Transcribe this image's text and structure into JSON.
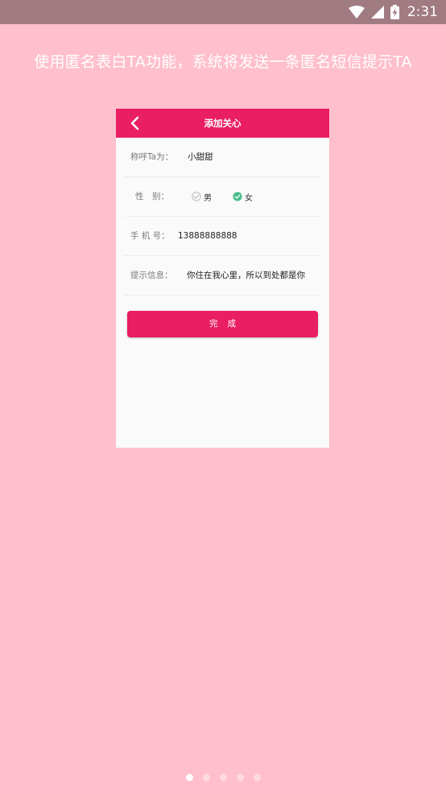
{
  "status_bar": {
    "time": "2:31",
    "icons": [
      "wifi-icon",
      "signal-icon",
      "battery-charging-icon"
    ]
  },
  "banner": {
    "text": "使用匿名表白TA功能，系统将发送一条匿名短信提示TA"
  },
  "card": {
    "title": "添加关心",
    "fields": {
      "nickname": {
        "label": "称呼Ta为：",
        "value": "小甜甜"
      },
      "gender": {
        "label": "性　别：",
        "options": [
          {
            "label": "男",
            "selected": false
          },
          {
            "label": "女",
            "selected": true
          }
        ]
      },
      "phone": {
        "label": "手 机 号：",
        "value": "13888888888"
      },
      "message": {
        "label": "提示信息：",
        "value": "你住在我心里，所以到处都是你"
      }
    },
    "done_label": "完成"
  },
  "pager": {
    "count": 5,
    "active_index": 0
  },
  "colors": {
    "background": "#ffbfcd",
    "status_bar": "#a17b82",
    "accent": "#e91e63",
    "check_selected": "#4cbd8c"
  }
}
